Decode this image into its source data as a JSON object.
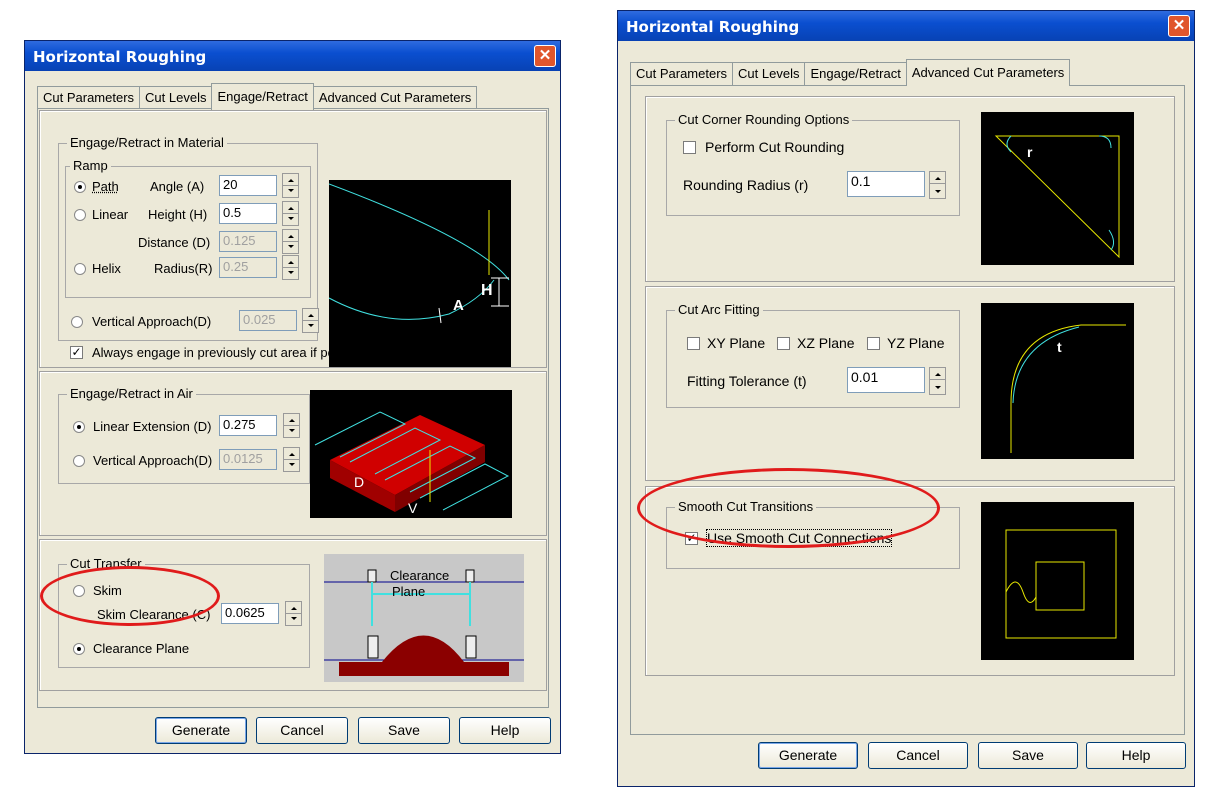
{
  "left": {
    "title": "Horizontal Roughing",
    "close": "✕",
    "tabs": [
      "Cut Parameters",
      "Cut Levels",
      "Engage/Retract",
      "Advanced Cut Parameters"
    ],
    "material": {
      "title": "Engage/Retract in Material",
      "ramp": "Ramp",
      "path": "Path",
      "linear": "Linear",
      "helix": "Helix",
      "angle_label": "Angle (A)",
      "angle": "20",
      "height_label": "Height (H)",
      "height": "0.5",
      "distance_label": "Distance (D)",
      "distance": "0.125",
      "radius_label": "Radius(R)",
      "radius": "0.25",
      "vertical_label": "Vertical Approach(D)",
      "vertical": "0.025",
      "always_engage": "Always engage in previously cut area if possible",
      "diagram": {
        "h": "H",
        "a": "A"
      }
    },
    "air": {
      "title": "Engage/Retract in Air",
      "linear_label": "Linear Extension (D)",
      "linear": "0.275",
      "vertical_label": "Vertical Approach(D)",
      "vertical": "0.0125",
      "diagram": {
        "d": "D",
        "v": "V"
      }
    },
    "transfer": {
      "title": "Cut Transfer",
      "skim": "Skim",
      "skim_clearance_label": "Skim Clearance (C)",
      "skim_clearance": "0.0625",
      "clearance_plane": "Clearance Plane",
      "diagram": {
        "line1": "Clearance",
        "line2": "Plane"
      }
    },
    "buttons": {
      "generate": "Generate",
      "cancel": "Cancel",
      "save": "Save",
      "help": "Help"
    }
  },
  "right": {
    "title": "Horizontal Roughing",
    "close": "✕",
    "tabs": [
      "Cut Parameters",
      "Cut Levels",
      "Engage/Retract",
      "Advanced Cut Parameters"
    ],
    "corner": {
      "title": "Cut Corner Rounding Options",
      "perform": "Perform Cut Rounding",
      "radius_label": "Rounding Radius (r)",
      "radius": "0.1",
      "diagram": {
        "r": "r"
      }
    },
    "arc": {
      "title": "Cut Arc Fitting",
      "xy": "XY Plane",
      "xz": "XZ Plane",
      "yz": "YZ Plane",
      "tol_label": "Fitting Tolerance (t)",
      "tol": "0.01",
      "diagram": {
        "t": "t"
      }
    },
    "smooth": {
      "title": "Smooth Cut Transitions",
      "use": "Use Smooth Cut Connections"
    },
    "buttons": {
      "generate": "Generate",
      "cancel": "Cancel",
      "save": "Save",
      "help": "Help"
    }
  },
  "colors": {
    "highlight_oval": "#e01b1b",
    "titlebar": "#0a4fd0",
    "dialog_bg": "#ece9d8"
  }
}
